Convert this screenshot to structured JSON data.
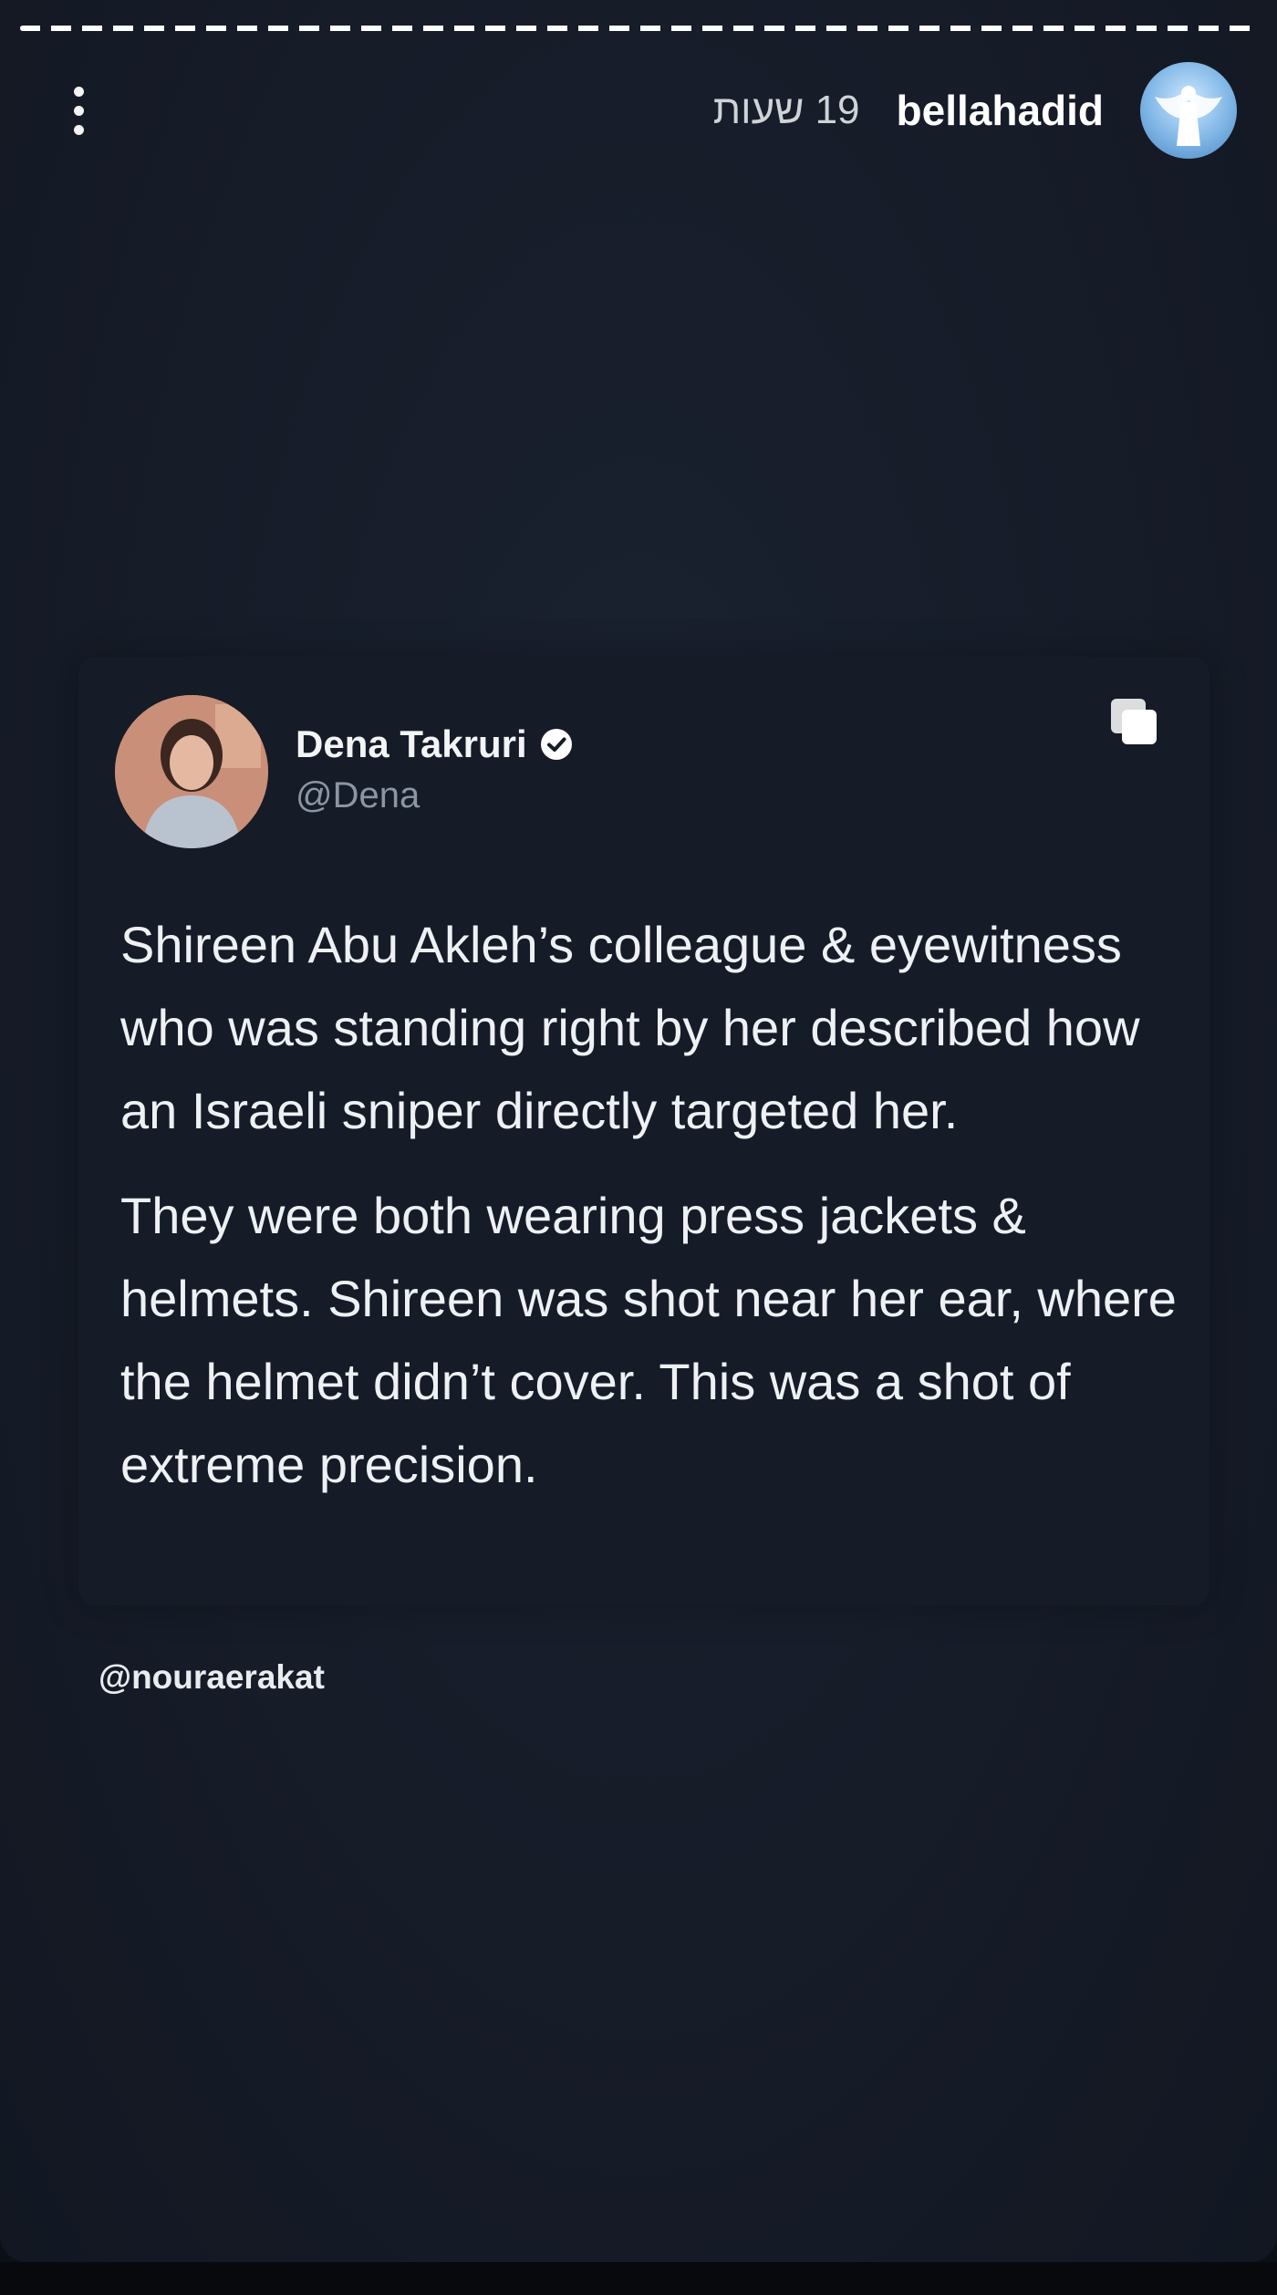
{
  "story": {
    "progress_fraction": 1.0,
    "header": {
      "username": "bellahadid",
      "time_ago": "19 שעות",
      "menu_icon": "more-vertical-icon",
      "avatar_icon": "angel-icon"
    }
  },
  "tweet": {
    "author_name": "Dena Takruri",
    "handle": "@Dena",
    "verified_icon": "verified-badge-icon",
    "copy_icon": "copy-icon",
    "paragraphs": [
      "Shireen Abu Akleh’s colleague & eyewitness who was standing right by her described how an Israeli sniper directly targeted her.",
      "They were both wearing press jackets & helmets. Shireen was shot near her ear, where the helmet didn’t cover. This was a shot of extreme precision."
    ]
  },
  "mention": "@nouraerakat"
}
